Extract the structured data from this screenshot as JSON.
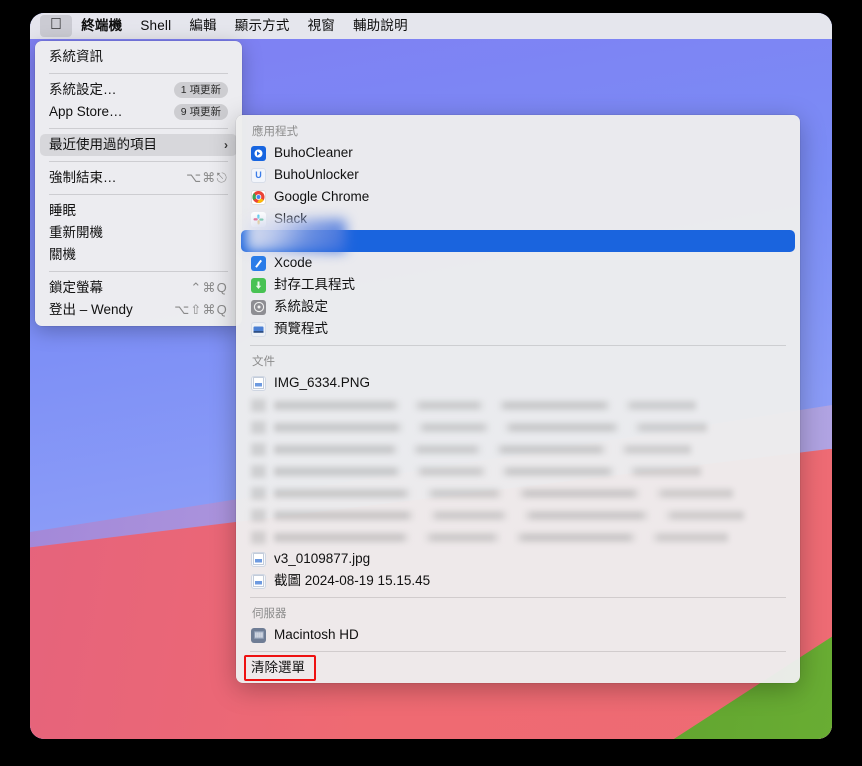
{
  "menubar": {
    "apple_icon": "apple-logo-icon",
    "items": [
      {
        "label": "終端機",
        "bold": true
      },
      {
        "label": "Shell",
        "bold": false
      },
      {
        "label": "編輯",
        "bold": false
      },
      {
        "label": "顯示方式",
        "bold": false
      },
      {
        "label": "視窗",
        "bold": false
      },
      {
        "label": "輔助說明",
        "bold": false
      }
    ]
  },
  "apple_menu": {
    "about": {
      "label": "系統資訊"
    },
    "system_settings": {
      "label": "系統設定…",
      "badge": "1 項更新"
    },
    "app_store": {
      "label": "App Store…",
      "badge": "9 項更新"
    },
    "recent_items": {
      "label": "最近使用過的項目",
      "chevron": "›"
    },
    "force_quit": {
      "label": "強制結束…",
      "shortcut": "⌥⌘⎋"
    },
    "sleep": {
      "label": "睡眠"
    },
    "restart": {
      "label": "重新開機"
    },
    "shutdown": {
      "label": "關機"
    },
    "lock_screen": {
      "label": "鎖定螢幕",
      "shortcut": "⌃⌘Q"
    },
    "log_out": {
      "label": "登出 – Wendy",
      "shortcut": "⌥⇧⌘Q"
    }
  },
  "recent_submenu": {
    "sections": [
      {
        "header": "應用程式",
        "items": [
          {
            "label": "BuhoCleaner",
            "icon": "buhocleaner-icon",
            "state": "normal"
          },
          {
            "label": "BuhoUnlocker",
            "icon": "buhounlocker-icon",
            "state": "normal"
          },
          {
            "label": "Google Chrome",
            "icon": "google-chrome-icon",
            "state": "normal"
          },
          {
            "label": "Slack",
            "icon": "slack-icon",
            "state": "normal"
          },
          {
            "label": "",
            "icon": "redacted-icon",
            "state": "selected-blurred"
          },
          {
            "label": "Xcode",
            "icon": "xcode-icon",
            "state": "normal"
          },
          {
            "label": "封存工具程式",
            "icon": "archive-utility-icon",
            "state": "normal"
          },
          {
            "label": "系統設定",
            "icon": "system-settings-icon",
            "state": "normal"
          },
          {
            "label": "預覽程式",
            "icon": "preview-app-icon",
            "state": "normal"
          }
        ]
      },
      {
        "header": "文件",
        "items": [
          {
            "label": "IMG_6334.PNG",
            "icon": "document-icon",
            "state": "normal"
          },
          {
            "label": "",
            "icon": "document-icon",
            "state": "blurred"
          },
          {
            "label": "",
            "icon": "document-icon",
            "state": "blurred"
          },
          {
            "label": "",
            "icon": "document-icon",
            "state": "blurred"
          },
          {
            "label": "",
            "icon": "document-icon",
            "state": "blurred"
          },
          {
            "label": "",
            "icon": "document-icon",
            "state": "blurred"
          },
          {
            "label": "",
            "icon": "document-icon",
            "state": "blurred"
          },
          {
            "label": "",
            "icon": "document-icon",
            "state": "blurred"
          },
          {
            "label": "v3_0109877.jpg",
            "icon": "document-icon",
            "state": "normal"
          },
          {
            "label": "截圖 2024-08-19 15.15.45",
            "icon": "document-icon",
            "state": "normal"
          }
        ]
      },
      {
        "header": "伺服器",
        "items": [
          {
            "label": "Macintosh HD",
            "icon": "hard-drive-icon",
            "state": "normal"
          }
        ]
      }
    ],
    "clear_menu": {
      "label": "清除選單",
      "highlight_color": "#ee1111"
    }
  },
  "colors": {
    "selection_blue": "#1a64de",
    "menu_background": "#ededed",
    "menubar_background": "#ececec",
    "wallpaper_blue": "#8295f7",
    "wallpaper_purple": "#ae9adf",
    "wallpaper_red": "#ee6b74",
    "wallpaper_green": "#65a931",
    "annotation_red": "#ee1111"
  }
}
